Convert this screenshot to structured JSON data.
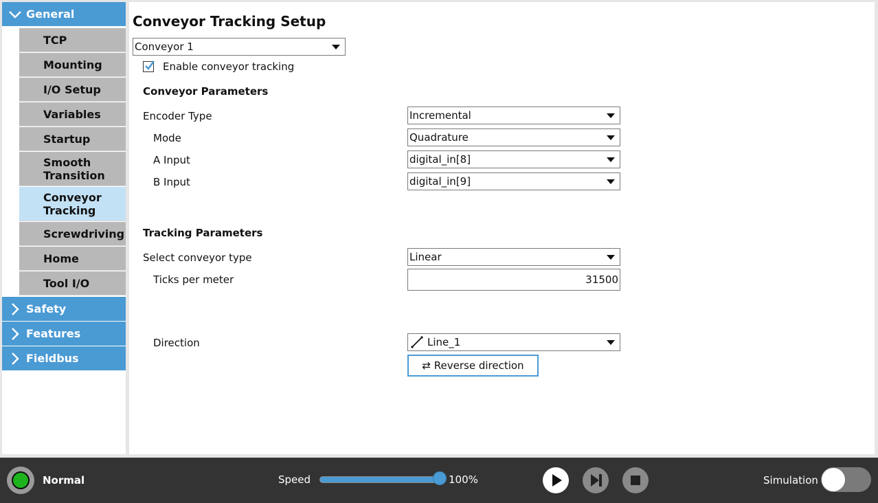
{
  "sidebar": {
    "categories": [
      {
        "label": "General",
        "expanded": true
      },
      {
        "label": "Safety",
        "expanded": false
      },
      {
        "label": "Features",
        "expanded": false
      },
      {
        "label": "Fieldbus",
        "expanded": false
      }
    ],
    "general_items": [
      {
        "label": "TCP"
      },
      {
        "label": "Mounting"
      },
      {
        "label": "I/O Setup"
      },
      {
        "label": "Variables"
      },
      {
        "label": "Startup"
      },
      {
        "label": "Smooth Transition"
      },
      {
        "label": "Conveyor Tracking",
        "active": true
      },
      {
        "label": "Screwdriving"
      },
      {
        "label": "Home"
      },
      {
        "label": "Tool I/O"
      }
    ]
  },
  "main": {
    "title": "Conveyor Tracking Setup",
    "conveyor_select": "Conveyor 1",
    "enable_label": "Enable conveyor tracking",
    "enable_checked": true,
    "conveyor_params": {
      "heading": "Conveyor Parameters",
      "encoder_type_label": "Encoder Type",
      "encoder_type_value": "Incremental",
      "mode_label": "Mode",
      "mode_value": "Quadrature",
      "a_input_label": "A Input",
      "a_input_value": "digital_in[8]",
      "b_input_label": "B Input",
      "b_input_value": "digital_in[9]"
    },
    "tracking_params": {
      "heading": "Tracking Parameters",
      "conveyor_type_label": "Select conveyor type",
      "conveyor_type_value": "Linear",
      "ticks_label": "Ticks per meter",
      "ticks_value": "31500",
      "direction_label": "Direction",
      "direction_value": "Line_1",
      "reverse_button": "⇄ Reverse direction"
    }
  },
  "bottombar": {
    "status": "Normal",
    "speed_label": "Speed",
    "speed_value": "100%",
    "speed_fraction": 1.0,
    "simulation_label": "Simulation",
    "simulation_on": false
  },
  "colors": {
    "accent": "#4a9ad4",
    "active_item": "#c3e1f5",
    "status_ok": "#1db31d"
  }
}
